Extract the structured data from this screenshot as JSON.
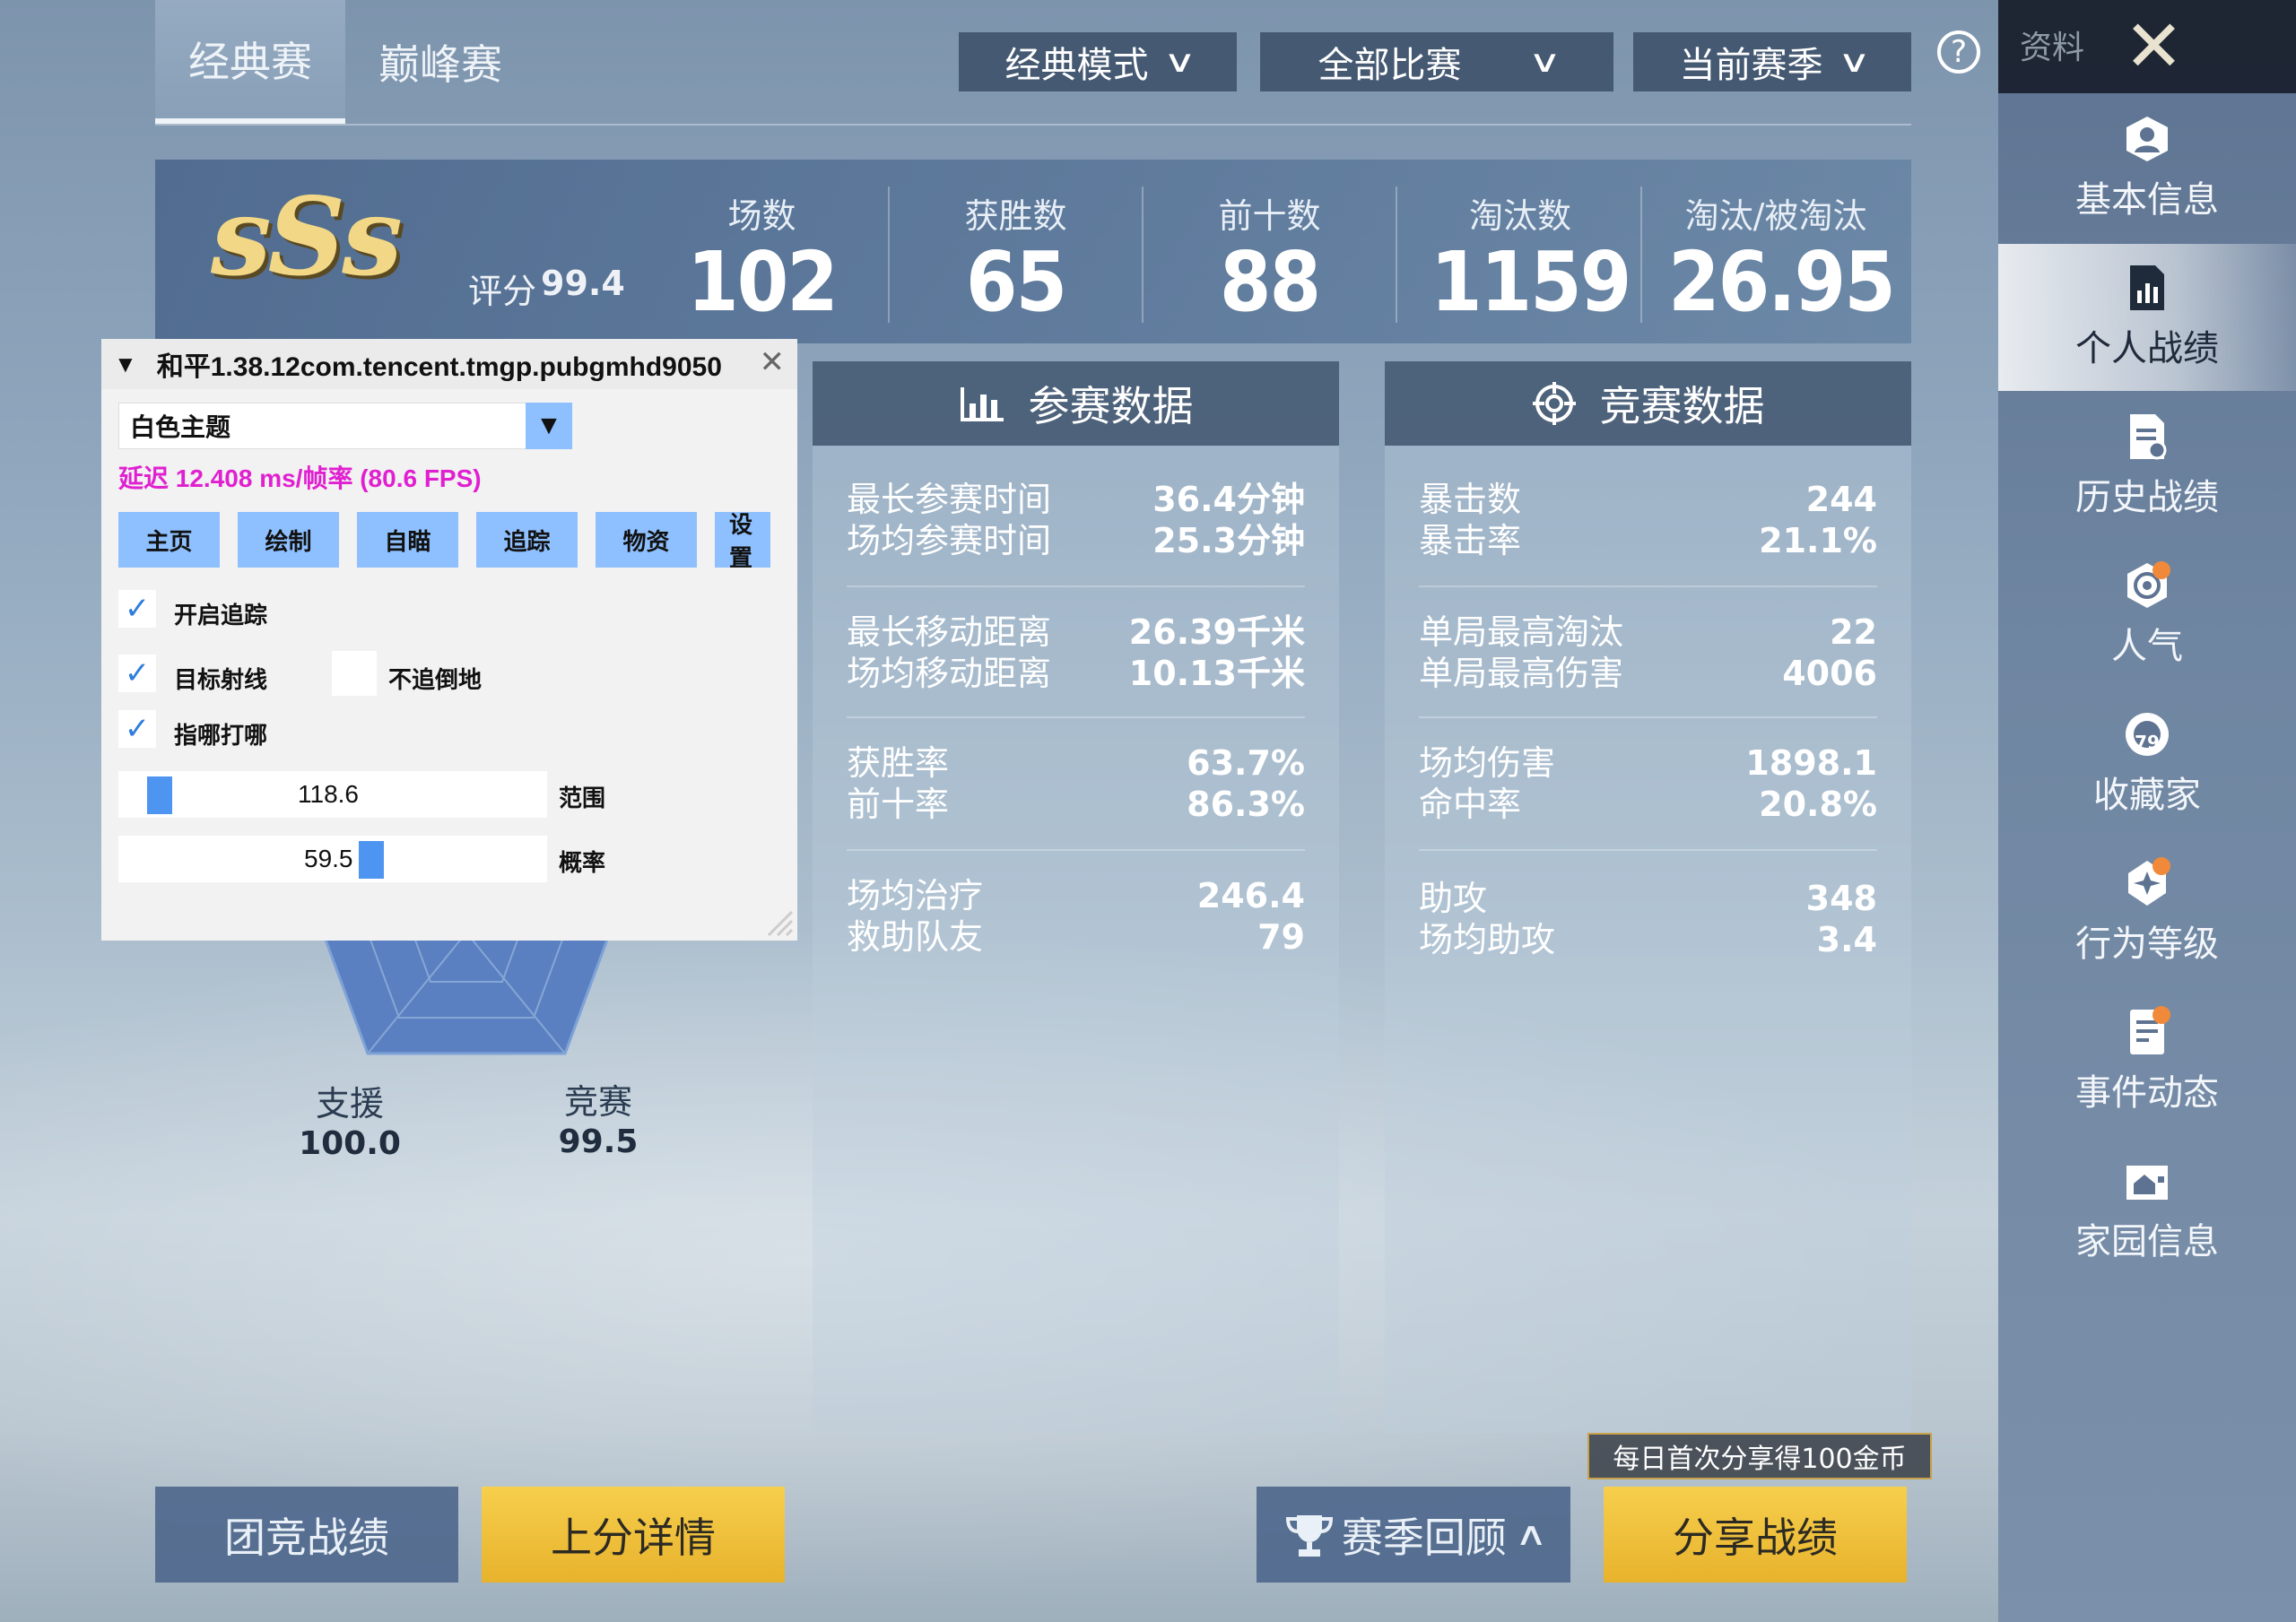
{
  "tabs": [
    {
      "label": "经典赛"
    },
    {
      "label": "巅峰赛"
    }
  ],
  "filters": [
    {
      "label": "经典模式"
    },
    {
      "label": "全部比赛"
    },
    {
      "label": "当前赛季"
    }
  ],
  "help_label": "?",
  "sidebar": {
    "header_label": "资料",
    "close_symbol": "✕",
    "items": [
      {
        "label": "基本信息",
        "icon": "profile-icon"
      },
      {
        "label": "个人战绩",
        "icon": "stats-report-icon"
      },
      {
        "label": "历史战绩",
        "icon": "history-document-icon"
      },
      {
        "label": "人气",
        "icon": "popularity-flower-icon"
      },
      {
        "label": "收藏家",
        "icon": "collector-badge-icon",
        "badge": "79"
      },
      {
        "label": "行为等级",
        "icon": "behavior-level-icon"
      },
      {
        "label": "事件动态",
        "icon": "event-feed-icon"
      },
      {
        "label": "家园信息",
        "icon": "home-icon"
      }
    ]
  },
  "summary": {
    "rank": "sSs",
    "score_label": "评分",
    "score_value": "99.4",
    "stats": [
      {
        "label": "场数",
        "value": "102"
      },
      {
        "label": "获胜数",
        "value": "65"
      },
      {
        "label": "前十数",
        "value": "88"
      },
      {
        "label": "淘汰数",
        "value": "1159"
      },
      {
        "label": "淘汰/被淘汰",
        "value": "26.95"
      }
    ]
  },
  "participation": {
    "title": "参赛数据",
    "groups": [
      [
        {
          "label": "最长参赛时间",
          "value": "36.4分钟"
        },
        {
          "label": "场均参赛时间",
          "value": "25.3分钟"
        }
      ],
      [
        {
          "label": "最长移动距离",
          "value": "26.39千米"
        },
        {
          "label": "场均移动距离",
          "value": "10.13千米"
        }
      ],
      [
        {
          "label": "获胜率",
          "value": "63.7%"
        },
        {
          "label": "前十率",
          "value": "86.3%"
        }
      ],
      [
        {
          "label": "场均治疗",
          "value": "246.4"
        },
        {
          "label": "救助队友",
          "value": "79"
        }
      ]
    ]
  },
  "competition": {
    "title": "竞赛数据",
    "groups": [
      [
        {
          "label": "暴击数",
          "value": "244"
        },
        {
          "label": "暴击率",
          "value": "21.1%"
        }
      ],
      [
        {
          "label": "单局最高淘汰",
          "value": "22"
        },
        {
          "label": "单局最高伤害",
          "value": "4006"
        }
      ],
      [
        {
          "label": "场均伤害",
          "value": "1898.1"
        },
        {
          "label": "命中率",
          "value": "20.8%"
        }
      ],
      [
        {
          "label": "助攻",
          "value": "348"
        },
        {
          "label": "场均助攻",
          "value": "3.4"
        }
      ]
    ]
  },
  "radar": {
    "labels": [
      {
        "name": "支援",
        "value": "100.0"
      },
      {
        "name": "竞赛",
        "value": "99.5"
      }
    ]
  },
  "bottom": {
    "team_button": "团竞战绩",
    "rank_detail_button": "上分详情",
    "season_review_button": "赛季回顾",
    "share_tip": "每日首次分享得100金币",
    "share_button": "分享战绩"
  },
  "overlay": {
    "title": "和平1.38.12com.tencent.tmgp.pubgmhd9050",
    "theme_select": "白色主题",
    "fps_text": "延迟 12.408 ms/帧率 (80.6 FPS)",
    "tabs": [
      "主页",
      "绘制",
      "自瞄",
      "追踪",
      "物资",
      "设置"
    ],
    "checkboxes": [
      {
        "label": "开启追踪",
        "checked": true
      },
      {
        "label": "目标射线",
        "checked": true
      },
      {
        "label": "不追倒地",
        "checked": false
      },
      {
        "label": "指哪打哪",
        "checked": true
      }
    ],
    "sliders": [
      {
        "label": "范围",
        "value": "118.6",
        "level": 0.05
      },
      {
        "label": "概率",
        "value": "59.5",
        "level": 0.6
      }
    ]
  }
}
